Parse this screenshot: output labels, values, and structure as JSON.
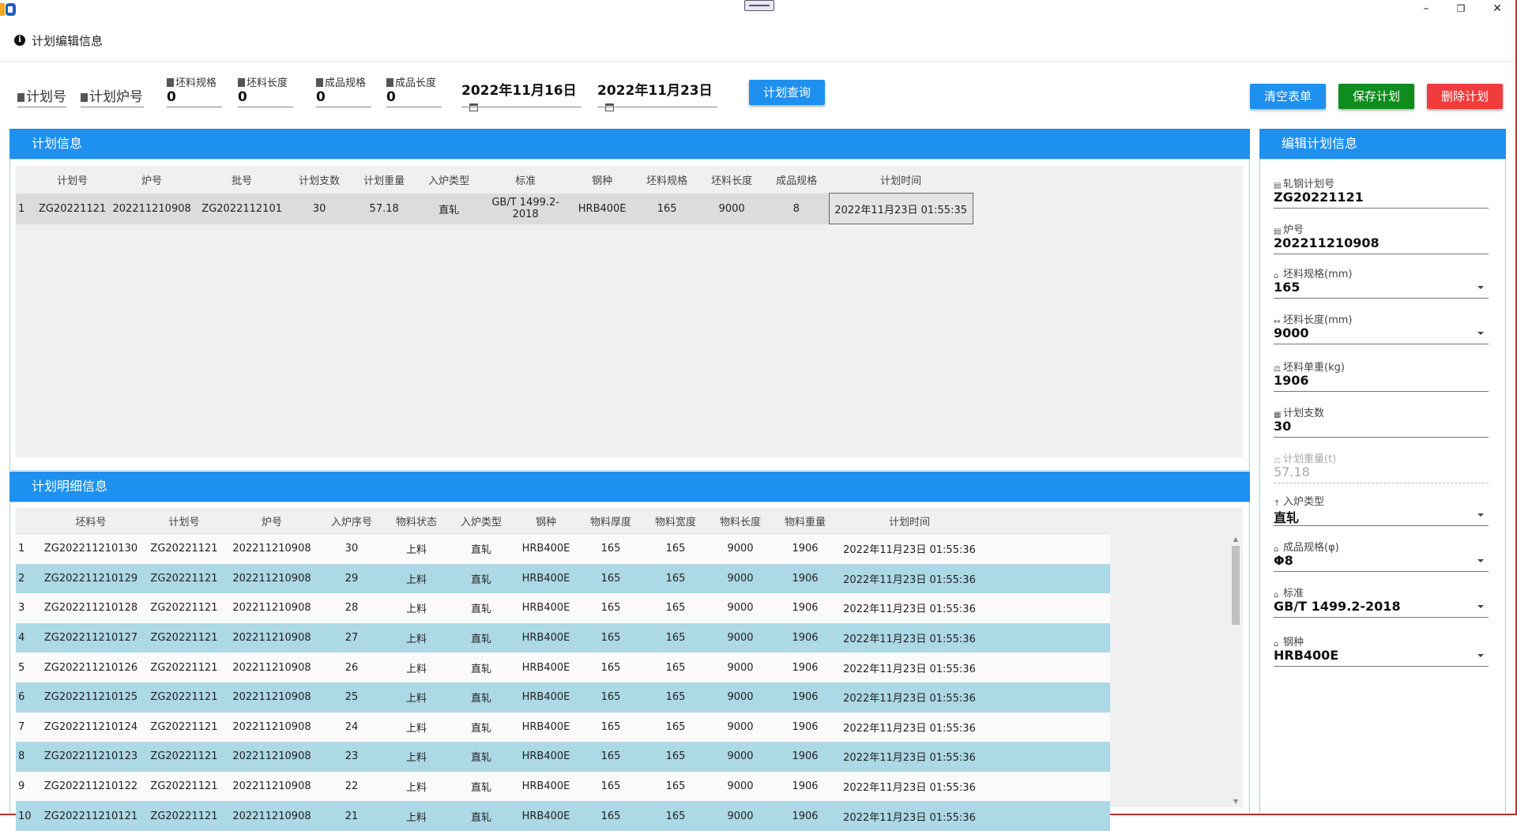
{
  "window": {
    "minimize": "–",
    "restore": "❐",
    "close": "✕"
  },
  "header": {
    "title": "计划编辑信息"
  },
  "toolbar": {
    "plan_no_label": "计划号",
    "furnace_no_label": "计划炉号",
    "blank_spec": {
      "label": "坯料规格",
      "value": "0"
    },
    "blank_length": {
      "label": "坯料长度",
      "value": "0"
    },
    "product_spec": {
      "label": "成品规格",
      "value": "0"
    },
    "product_length": {
      "label": "成品长度",
      "value": "0"
    },
    "date_from": "2022年11月16日",
    "date_to": "2022年11月23日",
    "query_button": "计划查询",
    "clear_button": "清空表单",
    "save_button": "保存计划",
    "delete_button": "删除计划"
  },
  "colors": {
    "panel_header": "#1e90f0",
    "clear_button": "#1e90f0",
    "save_button": "#0e8c1e",
    "delete_button": "#f03c3c",
    "alt_row": "#add8e6"
  },
  "plan_panel": {
    "title": "计划信息",
    "columns": [
      "计划号",
      "炉号",
      "批号",
      "计划支数",
      "计划重量",
      "入炉类型",
      "标准",
      "钢种",
      "坯料规格",
      "坯料长度",
      "成品规格",
      "计划时间"
    ],
    "rows": [
      {
        "index": "1",
        "cells": [
          "ZG20221121",
          "202211210908",
          "ZG2022112101",
          "30",
          "57.18",
          "直轧",
          "GB/T 1499.2-2018",
          "HRB400E",
          "165",
          "9000",
          "8",
          "2022年11月23日 01:55:35"
        ]
      }
    ]
  },
  "detail_panel": {
    "title": "计划明细信息",
    "columns": [
      "坯料号",
      "计划号",
      "炉号",
      "入炉序号",
      "物料状态",
      "入炉类型",
      "钢种",
      "物料厚度",
      "物料宽度",
      "物料长度",
      "物料重量",
      "计划时间"
    ],
    "rows": [
      {
        "index": "1",
        "cells": [
          "ZG202211210130",
          "ZG20221121",
          "202211210908",
          "30",
          "上料",
          "直轧",
          "HRB400E",
          "165",
          "165",
          "9000",
          "1906",
          "2022年11月23日 01:55:36"
        ]
      },
      {
        "index": "2",
        "cells": [
          "ZG202211210129",
          "ZG20221121",
          "202211210908",
          "29",
          "上料",
          "直轧",
          "HRB400E",
          "165",
          "165",
          "9000",
          "1906",
          "2022年11月23日 01:55:36"
        ]
      },
      {
        "index": "3",
        "cells": [
          "ZG202211210128",
          "ZG20221121",
          "202211210908",
          "28",
          "上料",
          "直轧",
          "HRB400E",
          "165",
          "165",
          "9000",
          "1906",
          "2022年11月23日 01:55:36"
        ]
      },
      {
        "index": "4",
        "cells": [
          "ZG202211210127",
          "ZG20221121",
          "202211210908",
          "27",
          "上料",
          "直轧",
          "HRB400E",
          "165",
          "165",
          "9000",
          "1906",
          "2022年11月23日 01:55:36"
        ]
      },
      {
        "index": "5",
        "cells": [
          "ZG202211210126",
          "ZG20221121",
          "202211210908",
          "26",
          "上料",
          "直轧",
          "HRB400E",
          "165",
          "165",
          "9000",
          "1906",
          "2022年11月23日 01:55:36"
        ]
      },
      {
        "index": "6",
        "cells": [
          "ZG202211210125",
          "ZG20221121",
          "202211210908",
          "25",
          "上料",
          "直轧",
          "HRB400E",
          "165",
          "165",
          "9000",
          "1906",
          "2022年11月23日 01:55:36"
        ]
      },
      {
        "index": "7",
        "cells": [
          "ZG202211210124",
          "ZG20221121",
          "202211210908",
          "24",
          "上料",
          "直轧",
          "HRB400E",
          "165",
          "165",
          "9000",
          "1906",
          "2022年11月23日 01:55:36"
        ]
      },
      {
        "index": "8",
        "cells": [
          "ZG202211210123",
          "ZG20221121",
          "202211210908",
          "23",
          "上料",
          "直轧",
          "HRB400E",
          "165",
          "165",
          "9000",
          "1906",
          "2022年11月23日 01:55:36"
        ]
      },
      {
        "index": "9",
        "cells": [
          "ZG202211210122",
          "ZG20221121",
          "202211210908",
          "22",
          "上料",
          "直轧",
          "HRB400E",
          "165",
          "165",
          "9000",
          "1906",
          "2022年11月23日 01:55:36"
        ]
      },
      {
        "index": "10",
        "cells": [
          "ZG202211210121",
          "ZG20221121",
          "202211210908",
          "21",
          "上料",
          "直轧",
          "HRB400E",
          "165",
          "165",
          "9000",
          "1906",
          "2022年11月23日 01:55:36"
        ]
      }
    ]
  },
  "edit_panel": {
    "title": "编辑计划信息",
    "fields": [
      {
        "label": "轧钢计划号",
        "value": "ZG20221121",
        "icon": "doc-icon",
        "dropdown": false,
        "disabled": false
      },
      {
        "label": "炉号",
        "value": "202211210908",
        "icon": "doc-icon",
        "dropdown": false,
        "disabled": false
      },
      {
        "label": "坯料规格(mm)",
        "value": "165",
        "icon": "tag-icon",
        "dropdown": true,
        "disabled": false
      },
      {
        "label": "坯料长度(mm)",
        "value": "9000",
        "icon": "ruler-icon",
        "dropdown": true,
        "disabled": false
      },
      {
        "label": "坯料单重(kg)",
        "value": "1906",
        "icon": "weight-icon",
        "dropdown": false,
        "disabled": false
      },
      {
        "label": "计划支数",
        "value": "30",
        "icon": "counter-icon",
        "dropdown": false,
        "disabled": false
      },
      {
        "label": "计划重量(t)",
        "value": "57.18",
        "icon": "weight-icon",
        "dropdown": false,
        "disabled": true
      },
      {
        "label": "入炉类型",
        "value": "直轧",
        "icon": "arrow-up-icon",
        "dropdown": true,
        "disabled": false
      },
      {
        "label": "成品规格(φ)",
        "value": "Φ8",
        "icon": "tag-icon",
        "dropdown": true,
        "disabled": false
      },
      {
        "label": "标准",
        "value": "GB/T 1499.2-2018",
        "icon": "tag-icon",
        "dropdown": true,
        "disabled": false
      },
      {
        "label": "钢种",
        "value": "HRB400E",
        "icon": "tag-icon",
        "dropdown": true,
        "disabled": false
      }
    ]
  }
}
